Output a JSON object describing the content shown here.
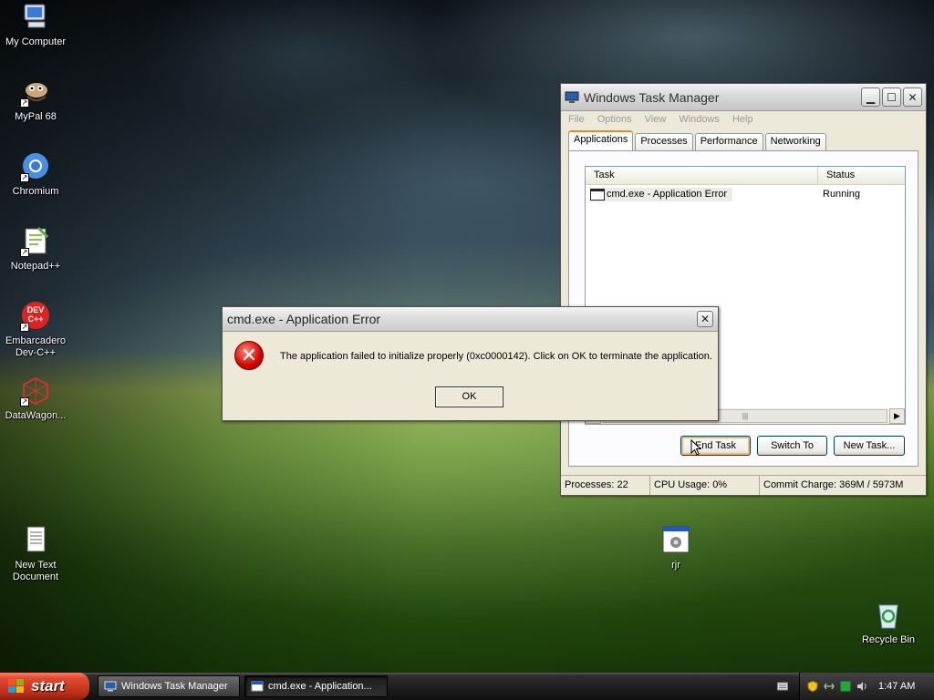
{
  "desktop": {
    "icons": [
      {
        "label": "My Computer",
        "icon": "my-computer-icon"
      },
      {
        "label": "MyPal 68",
        "icon": "mypal-icon"
      },
      {
        "label": "Chromium",
        "icon": "chromium-icon"
      },
      {
        "label": "Notepad++",
        "icon": "notepadpp-icon"
      },
      {
        "label": "Embarcadero Dev-C++",
        "icon": "devcpp-icon",
        "badge": "DEV C++"
      },
      {
        "label": "DataWagon...",
        "icon": "datawagon-icon"
      },
      {
        "label": "New Text Document",
        "icon": "text-document-icon"
      },
      {
        "label": "rjr",
        "icon": "executable-icon"
      },
      {
        "label": "Recycle Bin",
        "icon": "recycle-bin-icon"
      }
    ]
  },
  "task_manager": {
    "title": "Windows Task Manager",
    "menu": [
      "File",
      "Options",
      "View",
      "Windows",
      "Help"
    ],
    "tabs": [
      "Applications",
      "Processes",
      "Performance",
      "Networking"
    ],
    "active_tab": "Applications",
    "columns": [
      "Task",
      "Status"
    ],
    "rows": [
      {
        "task": "cmd.exe - Application Error",
        "status": "Running"
      }
    ],
    "buttons": {
      "end_task": "End Task",
      "switch_to": "Switch To",
      "new_task": "New Task..."
    },
    "status": {
      "processes": "Processes: 22",
      "cpu": "CPU Usage: 0%",
      "commit": "Commit Charge: 369M / 5973M"
    }
  },
  "error_dialog": {
    "title": "cmd.exe - Application Error",
    "message": "The application failed to initialize properly (0xc0000142). Click on OK to terminate the application.",
    "ok_label": "OK",
    "close_glyph": "✕",
    "icon_glyph": "✕"
  },
  "taskbar": {
    "start_label": "start",
    "tasks": [
      {
        "label": "Windows Task Manager",
        "active": false
      },
      {
        "label": "cmd.exe - Application...",
        "active": true
      }
    ],
    "clock": "1:47 AM"
  },
  "colors": {
    "accent_tab": "#e68b2c",
    "error_red": "#d40000",
    "start_red": "#c0311b"
  }
}
